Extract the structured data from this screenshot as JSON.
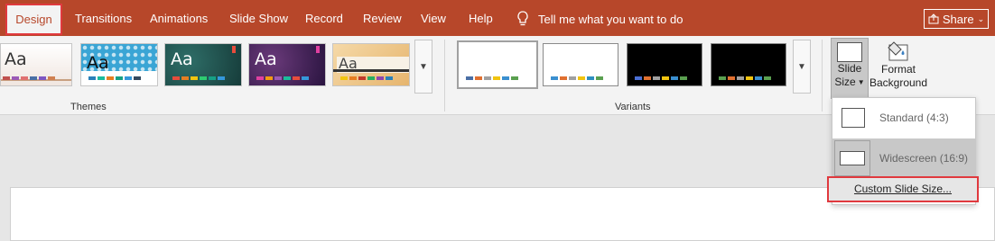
{
  "tabs": {
    "design": "Design",
    "transitions": "Transitions",
    "animations": "Animations",
    "slideshow": "Slide Show",
    "record": "Record",
    "review": "Review",
    "view": "View",
    "help": "Help"
  },
  "tell_me": "Tell me what you want to do",
  "share": "Share",
  "themes_label": "Themes",
  "variants_label": "Variants",
  "theme_text": "Aa",
  "slide_size": {
    "line1": "Slide",
    "line2": "Size"
  },
  "format_background": {
    "line1": "Format",
    "line2": "Background"
  },
  "dropdown": {
    "standard": "Standard (4:3)",
    "widescreen": "Widescreen (16:9)",
    "custom": "Custom Slide Size..."
  },
  "colors": {
    "accent": "#b7472a",
    "highlight": "#e0393e"
  }
}
